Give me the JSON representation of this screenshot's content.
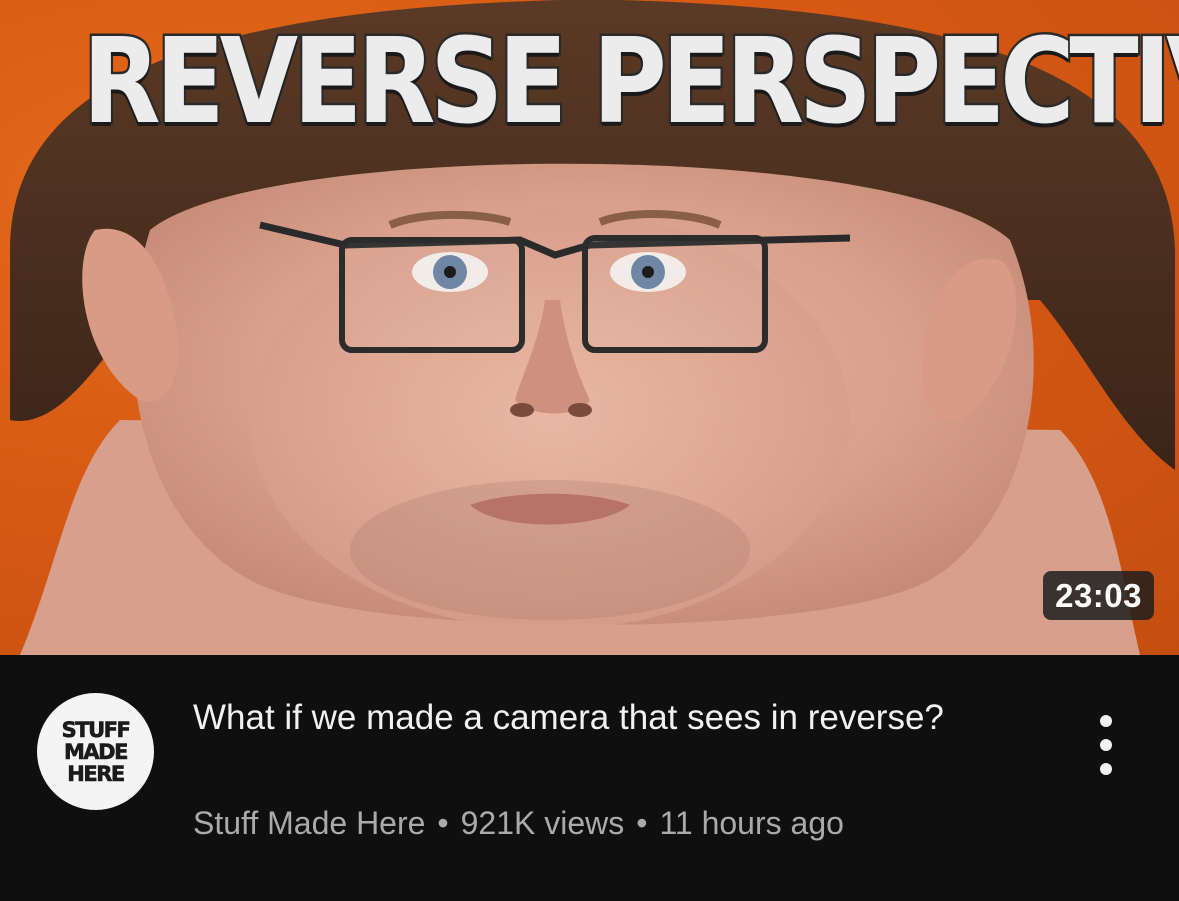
{
  "video": {
    "thumbnail_text": "REVERSE PERSPECTIVE?",
    "duration": "23:03",
    "title": "What if we made a camera that sees in reverse?",
    "channel": "Stuff Made Here",
    "views": "921K views",
    "age": "11 hours ago",
    "separator": "•"
  },
  "channel_avatar": {
    "lines": [
      "STUFF",
      "MADE",
      "HERE"
    ]
  },
  "icons": {
    "menu": "more-vert-icon"
  },
  "colors": {
    "background": "#0f0f0f",
    "thumbnail_bg": "#d85a14",
    "title": "#f1f1f1",
    "meta": "#aaaaaa",
    "avatar_bg": "#f4f4f4"
  }
}
